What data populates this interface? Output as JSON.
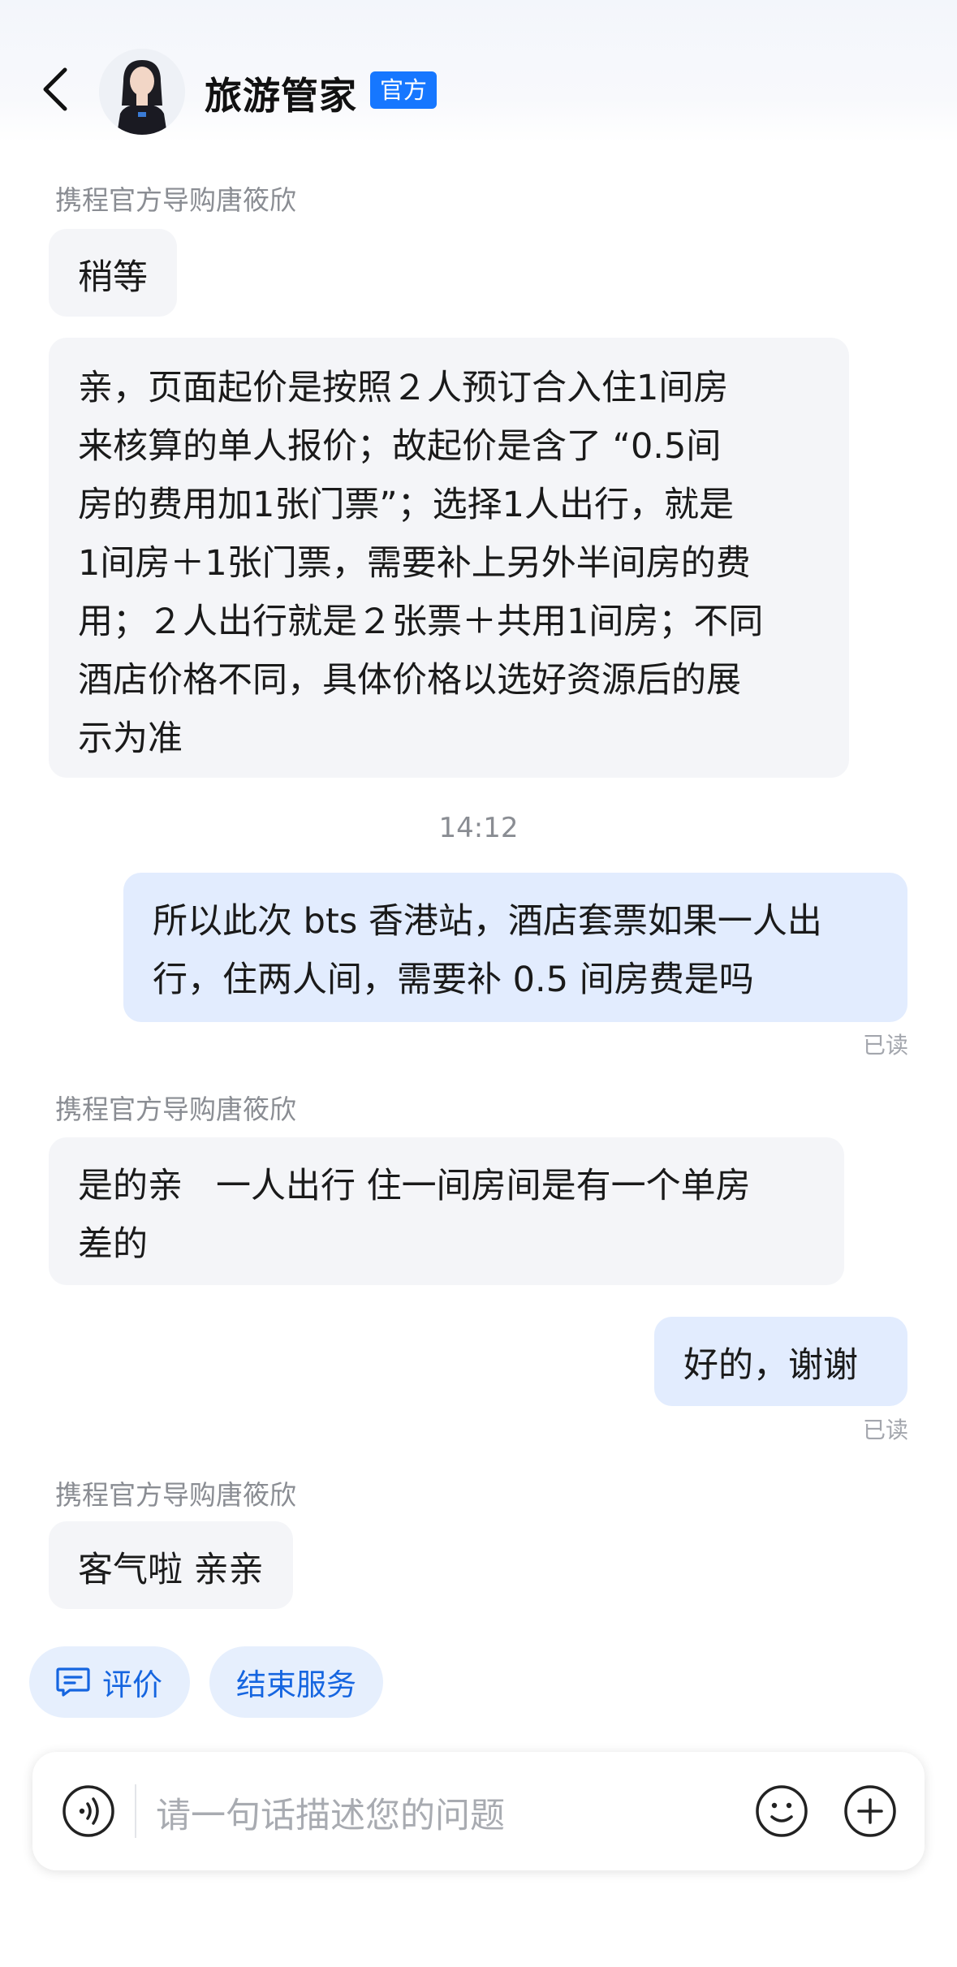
{
  "header": {
    "title": "旅游管家",
    "badge": "官方"
  },
  "messages": {
    "m1_sender": "携程官方导购唐筱欣",
    "m1_text": "稍等",
    "m2_line1": "亲，页面起价是按照２人预订合入住1间房",
    "m2_line2": "来核算的单人报价；故起价是含了 “0.5间",
    "m2_line3": "房的费用加1张门票”；选择1人出行，就是",
    "m2_line4": "1间房＋1张门票，需要补上另外半间房的费",
    "m2_line5": "用；２人出行就是２张票＋共用1间房；不同",
    "m2_line6": "酒店价格不同，具体价格以选好资源后的展",
    "m2_line7": "示为准",
    "time": "14:12",
    "m3_line1": "所以此次 bts 香港站，酒店套票如果一人出",
    "m3_line2": "行，住两人间，需要补 0.5 间房费是吗",
    "m3_status": "已读",
    "m4_sender": "携程官方导购唐筱欣",
    "m4_line1": "是的亲   一人出行 住一间房间是有一个单房",
    "m4_line2": "差的",
    "m5_text": "好的，谢谢",
    "m5_status": "已读",
    "m6_sender": "携程官方导购唐筱欣",
    "m6_text": "客气啦 亲亲"
  },
  "actions": {
    "rate": "评价",
    "end": "结束服务"
  },
  "input": {
    "placeholder": "请一句话描述您的问题"
  },
  "colors": {
    "accent": "#1677ff",
    "outgoing_bubble": "#e2ecfe",
    "incoming_bubble": "#f4f5f8",
    "chip_bg": "#e6effd",
    "chip_text": "#1565e0"
  },
  "icons": {
    "back": "chevron-left-icon",
    "rate": "comment-icon",
    "voice": "voice-icon",
    "emoji": "emoji-icon",
    "plus": "plus-circle-icon"
  }
}
